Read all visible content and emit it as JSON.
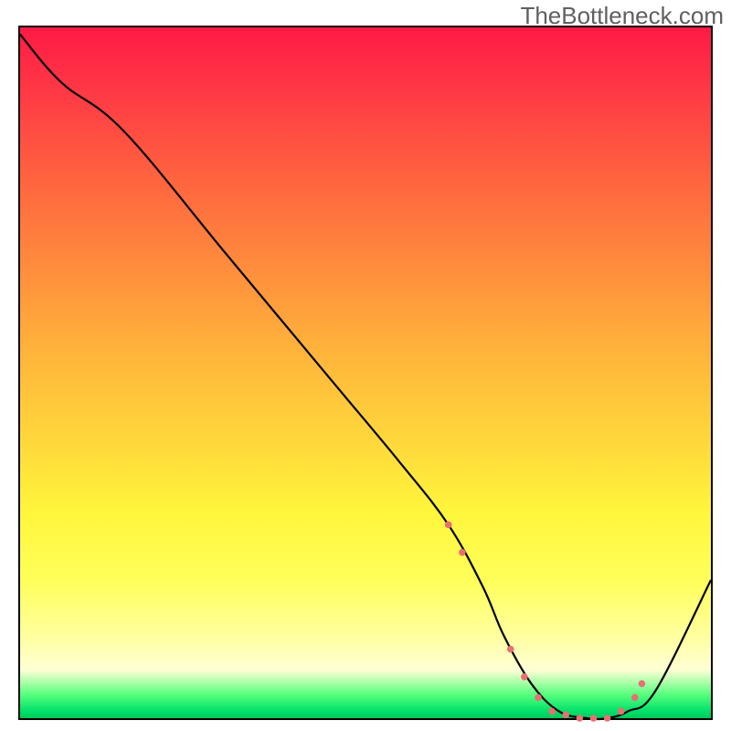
{
  "source_watermark": "TheBottleneck.com",
  "chart_data": {
    "type": "line",
    "title": "",
    "xlabel": "",
    "ylabel": "",
    "xlim": [
      0,
      100
    ],
    "ylim": [
      0,
      100
    ],
    "x": [
      0,
      6,
      15,
      30,
      45,
      55,
      62,
      67,
      70,
      74,
      78,
      82,
      85,
      88,
      92,
      100
    ],
    "values": [
      99,
      92,
      85,
      67,
      49,
      37,
      28,
      19,
      12,
      5,
      1,
      0,
      0,
      1,
      4,
      20
    ],
    "series_name": "bottleneck-curve",
    "markers": [
      {
        "x": 62,
        "y": 28
      },
      {
        "x": 64,
        "y": 24
      },
      {
        "x": 71,
        "y": 10
      },
      {
        "x": 73,
        "y": 6
      },
      {
        "x": 75,
        "y": 3
      },
      {
        "x": 77,
        "y": 1
      },
      {
        "x": 79,
        "y": 0.5
      },
      {
        "x": 81,
        "y": 0
      },
      {
        "x": 83,
        "y": 0
      },
      {
        "x": 85,
        "y": 0
      },
      {
        "x": 87,
        "y": 1
      },
      {
        "x": 89,
        "y": 3
      },
      {
        "x": 90,
        "y": 5
      }
    ],
    "marker_style": {
      "shape": "circle",
      "color": "#e96f72",
      "radius": 3.8
    }
  }
}
